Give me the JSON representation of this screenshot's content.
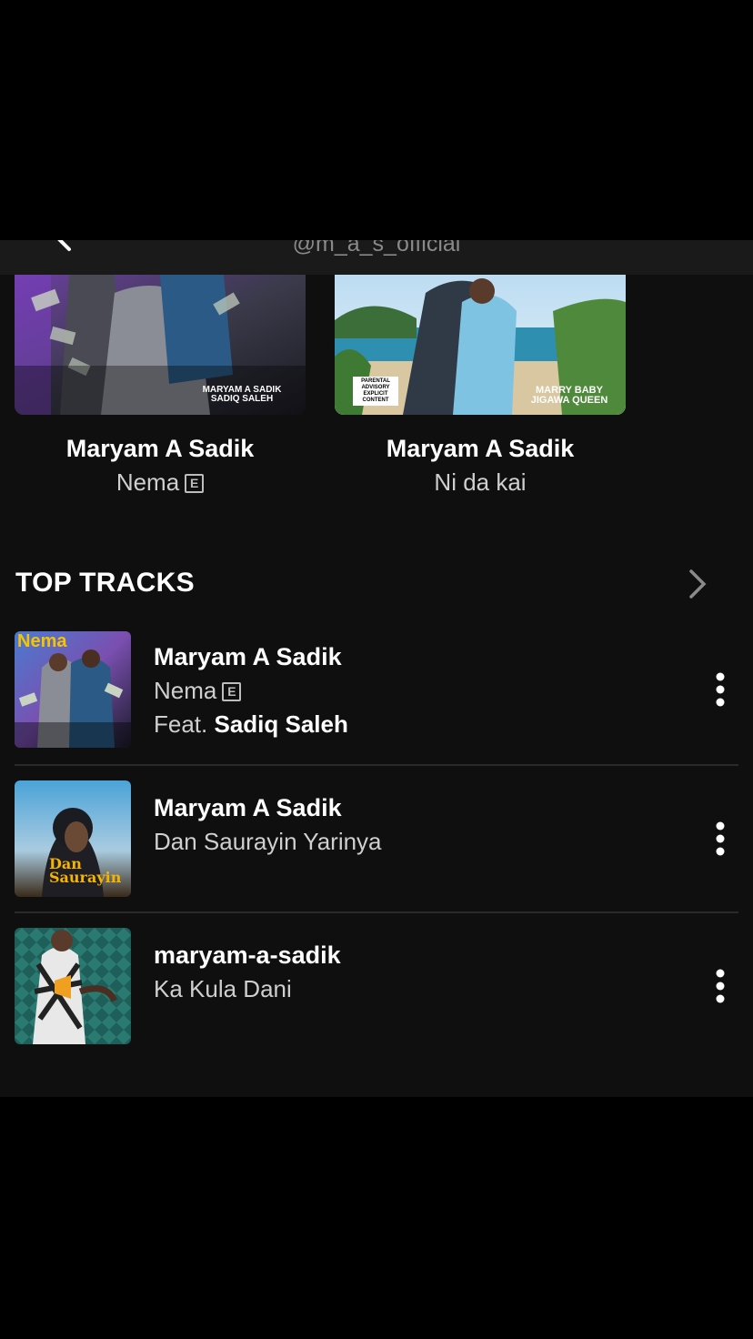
{
  "header": {
    "handle": "@m_a_s_official",
    "back_icon": "back-arrow-icon"
  },
  "albums": [
    {
      "artist": "Maryam A Sadik",
      "title": "Nema",
      "explicit_badge": "E",
      "cover_text": "MARYAM A SADIK SADIQ SALEH"
    },
    {
      "artist": "Maryam A Sadik",
      "title": "Ni da kai",
      "cover_text": "MARRY BABY JIGAWA QUEEN",
      "advisory": "PARENTAL ADVISORY EXPLICIT CONTENT"
    }
  ],
  "top_tracks": {
    "title": "TOP TRACKS",
    "more_icon": "chevron-right-icon",
    "tracks": [
      {
        "artist": "Maryam A Sadik",
        "title": "Nema",
        "explicit_badge": "E",
        "feat_label": "Feat.",
        "feat_artist": "Sadiq Saleh",
        "cover_text": "Nema"
      },
      {
        "artist": "Maryam A Sadik",
        "title": "Dan Saurayin Yarinya",
        "cover_text": "Dan Saurayin"
      },
      {
        "artist": "maryam-a-sadik",
        "title": "Ka Kula Dani"
      }
    ]
  },
  "colors": {
    "background": "#0f0f10",
    "header_bg": "#1a1a1b",
    "text_primary": "#ffffff",
    "text_secondary": "#cfcfcf",
    "divider": "#2a2a2b"
  }
}
